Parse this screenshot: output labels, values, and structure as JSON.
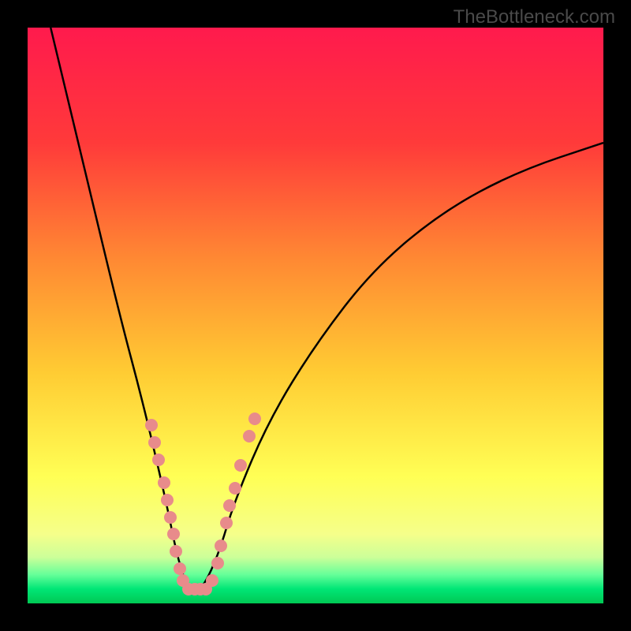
{
  "watermark_text": "TheBottleneck.com",
  "chart_data": {
    "type": "line",
    "title": "",
    "xlabel": "",
    "ylabel": "",
    "xlim": [
      0,
      100
    ],
    "ylim": [
      0,
      100
    ],
    "gradient_colors": {
      "top": "#ff1744",
      "upper_mid": "#ff5533",
      "mid": "#ffcc33",
      "lower_mid": "#ffff66",
      "green_band": "#00e676",
      "bottom_green": "#00c853"
    },
    "curve": {
      "description": "V-shaped bottleneck curve descending from top-left, reaching minimum around x=28, rising back toward upper right",
      "approximate_points": [
        {
          "x": 4,
          "y": 100
        },
        {
          "x": 10,
          "y": 75
        },
        {
          "x": 16,
          "y": 50
        },
        {
          "x": 20,
          "y": 35
        },
        {
          "x": 24,
          "y": 18
        },
        {
          "x": 26,
          "y": 8
        },
        {
          "x": 28,
          "y": 2
        },
        {
          "x": 30,
          "y": 2
        },
        {
          "x": 33,
          "y": 8
        },
        {
          "x": 36,
          "y": 18
        },
        {
          "x": 42,
          "y": 32
        },
        {
          "x": 50,
          "y": 45
        },
        {
          "x": 60,
          "y": 58
        },
        {
          "x": 72,
          "y": 68
        },
        {
          "x": 85,
          "y": 75
        },
        {
          "x": 100,
          "y": 80
        }
      ]
    },
    "data_points": {
      "description": "Salmon colored scatter points clustered along both arms of the V near the bottom",
      "points": [
        {
          "x": 21.5,
          "y": 31
        },
        {
          "x": 22,
          "y": 28
        },
        {
          "x": 22.8,
          "y": 25
        },
        {
          "x": 23.7,
          "y": 21
        },
        {
          "x": 24.2,
          "y": 18
        },
        {
          "x": 24.8,
          "y": 15
        },
        {
          "x": 25.3,
          "y": 12
        },
        {
          "x": 25.8,
          "y": 9
        },
        {
          "x": 26.5,
          "y": 6
        },
        {
          "x": 27,
          "y": 4
        },
        {
          "x": 28,
          "y": 2.5
        },
        {
          "x": 29,
          "y": 2.5
        },
        {
          "x": 30,
          "y": 2.5
        },
        {
          "x": 31,
          "y": 2.5
        },
        {
          "x": 32,
          "y": 4
        },
        {
          "x": 33,
          "y": 7
        },
        {
          "x": 33.5,
          "y": 10
        },
        {
          "x": 34.5,
          "y": 14
        },
        {
          "x": 35,
          "y": 17
        },
        {
          "x": 36,
          "y": 20
        },
        {
          "x": 37,
          "y": 24
        },
        {
          "x": 38.5,
          "y": 29
        },
        {
          "x": 39.5,
          "y": 32
        }
      ]
    }
  }
}
